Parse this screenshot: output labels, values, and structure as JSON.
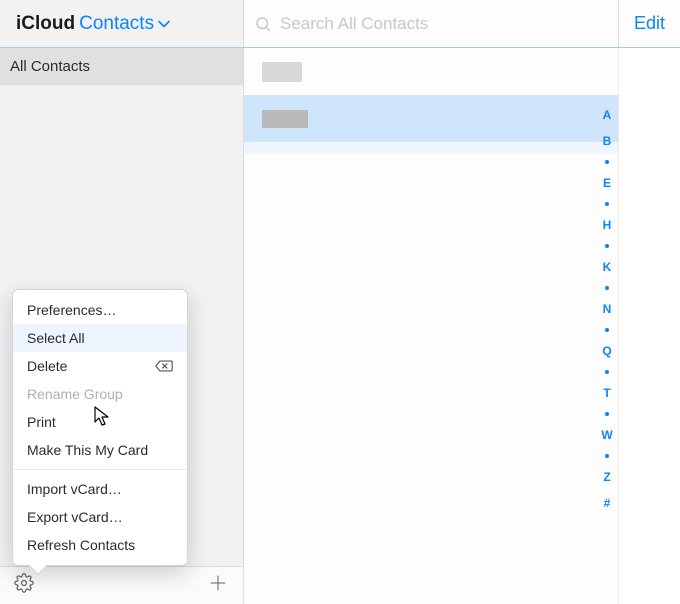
{
  "header": {
    "brand_left": "iCloud",
    "brand_right": "Contacts",
    "search_placeholder": "Search All Contacts",
    "edit_label": "Edit"
  },
  "sidebar": {
    "group": "All Contacts"
  },
  "index_rail": [
    "A",
    "B",
    "•",
    "E",
    "•",
    "H",
    "•",
    "K",
    "•",
    "N",
    "•",
    "Q",
    "•",
    "T",
    "•",
    "W",
    "•",
    "Z",
    "#"
  ],
  "menu": {
    "items0": [
      {
        "label": "Preferences…",
        "hover": false,
        "disabled": false
      },
      {
        "label": "Select All",
        "hover": true,
        "disabled": false
      },
      {
        "label": "Delete",
        "hover": false,
        "disabled": false,
        "trailing_icon": "delete"
      },
      {
        "label": "Rename Group",
        "hover": false,
        "disabled": true
      },
      {
        "label": "Print",
        "hover": false,
        "disabled": false
      },
      {
        "label": "Make This My Card",
        "hover": false,
        "disabled": false
      }
    ],
    "items1": [
      {
        "label": "Import vCard…",
        "hover": false,
        "disabled": false
      },
      {
        "label": "Export vCard…",
        "hover": false,
        "disabled": false
      },
      {
        "label": "Refresh Contacts",
        "hover": false,
        "disabled": false
      }
    ]
  }
}
